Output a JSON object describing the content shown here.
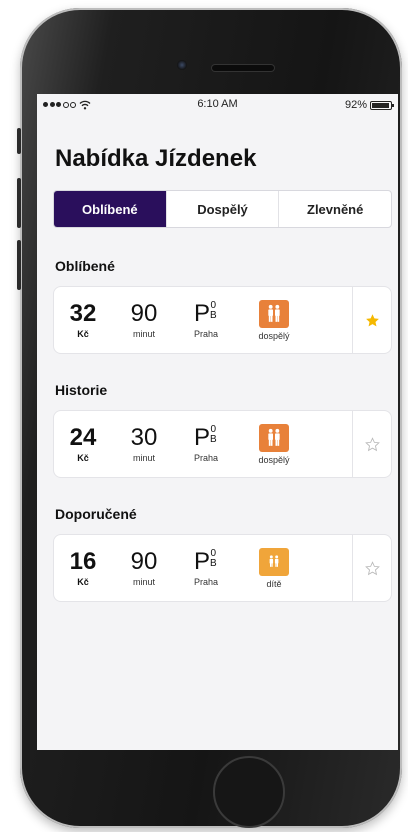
{
  "status_bar": {
    "time": "6:10 AM",
    "battery": "92%",
    "signal_dots_filled": 3,
    "signal_dots_total": 5
  },
  "title": "Nabídka Jízdenek",
  "tabs": [
    {
      "label": "Oblíbené",
      "active": true
    },
    {
      "label": "Dospělý",
      "active": false
    },
    {
      "label": "Zlevněné",
      "active": false
    }
  ],
  "sections": [
    {
      "title": "Oblíbené",
      "ticket": {
        "price": "32",
        "currency": "Kč",
        "duration": "90",
        "duration_unit": "minut",
        "zone_letter": "P",
        "zone_top": "0",
        "zone_bottom": "B",
        "zone_label": "Praha",
        "passenger": "dospělý",
        "passenger_icon": "adults-icon",
        "favorite": true
      }
    },
    {
      "title": "Historie",
      "ticket": {
        "price": "24",
        "currency": "Kč",
        "duration": "30",
        "duration_unit": "minut",
        "zone_letter": "P",
        "zone_top": "0",
        "zone_bottom": "B",
        "zone_label": "Praha",
        "passenger": "dospělý",
        "passenger_icon": "adults-icon",
        "favorite": false
      }
    },
    {
      "title": "Doporučené",
      "ticket": {
        "price": "16",
        "currency": "Kč",
        "duration": "90",
        "duration_unit": "minut",
        "zone_letter": "P",
        "zone_top": "0",
        "zone_bottom": "B",
        "zone_label": "Praha",
        "passenger": "dítě",
        "passenger_icon": "children-icon",
        "favorite": false
      }
    }
  ],
  "colors": {
    "accent": "#2a0f5c",
    "adult_icon": "#e8813a",
    "child_icon": "#f0a53a",
    "star_active": "#f5b800",
    "star_inactive": "#b8b8b8"
  }
}
